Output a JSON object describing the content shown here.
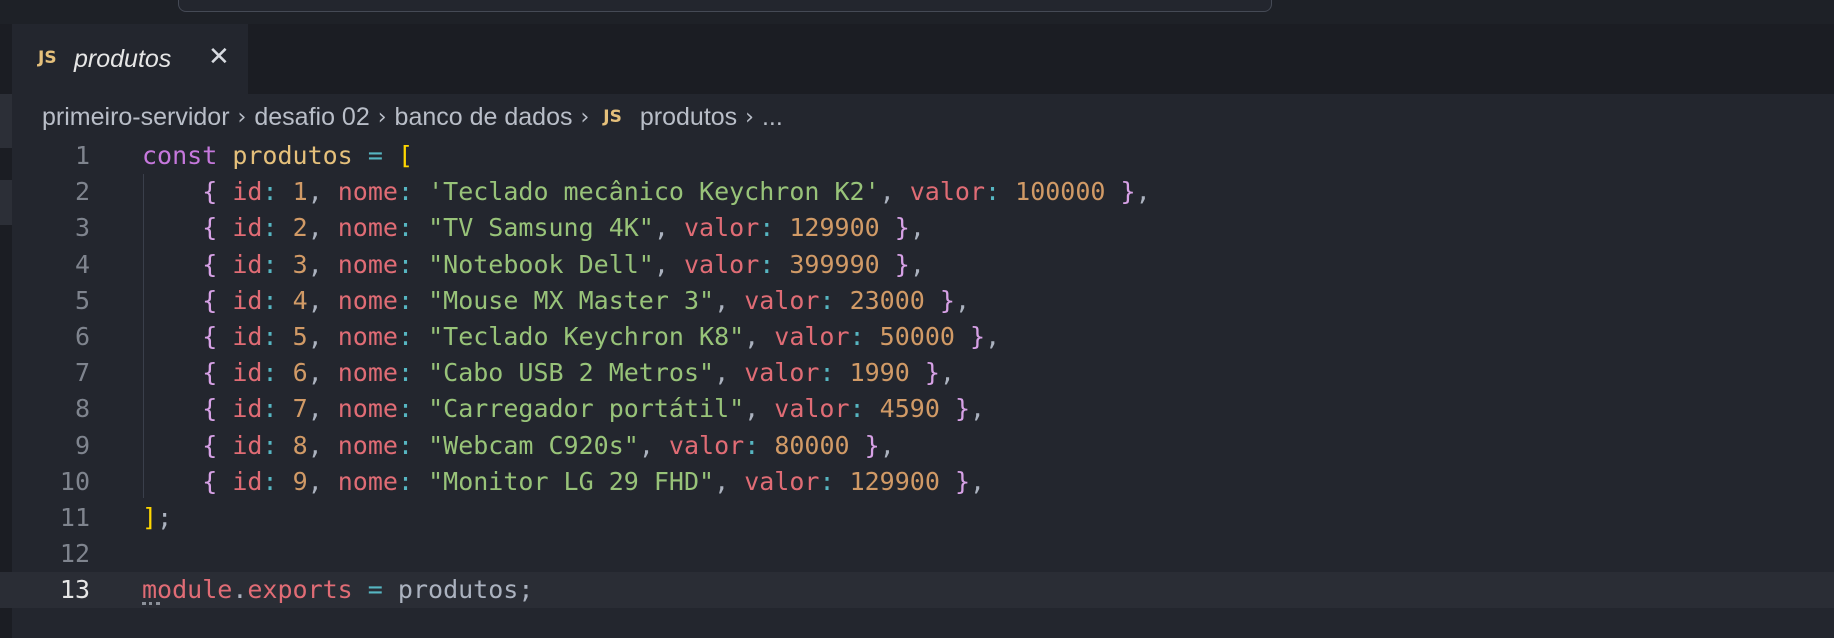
{
  "tab": {
    "icon": "JS",
    "title": "produtos",
    "close_icon": "close-icon"
  },
  "breadcrumb": {
    "items": [
      "primeiro-servidor",
      "desafio 02",
      "banco de dados",
      "produtos",
      "..."
    ],
    "file_icon": "JS"
  },
  "code": {
    "current_line": 13,
    "lines": [
      {
        "n": "1",
        "tokens": [
          [
            "k",
            "const"
          ],
          [
            "pl",
            " "
          ],
          [
            "v",
            "produtos"
          ],
          [
            "pl",
            " "
          ],
          [
            "o",
            "="
          ],
          [
            "pl",
            " "
          ],
          [
            "br1",
            "["
          ]
        ]
      },
      {
        "n": "2",
        "tokens": [
          [
            "pl",
            "    "
          ],
          [
            "b",
            "{"
          ],
          [
            "pl",
            " "
          ],
          [
            "p",
            "id"
          ],
          [
            "o",
            ":"
          ],
          [
            "pl",
            " "
          ],
          [
            "n",
            "1"
          ],
          [
            "pl",
            ", "
          ],
          [
            "p",
            "nome"
          ],
          [
            "o",
            ":"
          ],
          [
            "pl",
            " "
          ],
          [
            "s",
            "'Teclado mecânico Keychron K2'"
          ],
          [
            "pl",
            ", "
          ],
          [
            "p",
            "valor"
          ],
          [
            "o",
            ":"
          ],
          [
            "pl",
            " "
          ],
          [
            "n",
            "100000"
          ],
          [
            "pl",
            " "
          ],
          [
            "b",
            "}"
          ],
          [
            "pl",
            ","
          ]
        ]
      },
      {
        "n": "3",
        "tokens": [
          [
            "pl",
            "    "
          ],
          [
            "b",
            "{"
          ],
          [
            "pl",
            " "
          ],
          [
            "p",
            "id"
          ],
          [
            "o",
            ":"
          ],
          [
            "pl",
            " "
          ],
          [
            "n",
            "2"
          ],
          [
            "pl",
            ", "
          ],
          [
            "p",
            "nome"
          ],
          [
            "o",
            ":"
          ],
          [
            "pl",
            " "
          ],
          [
            "s",
            "\"TV Samsung 4K\""
          ],
          [
            "pl",
            ", "
          ],
          [
            "p",
            "valor"
          ],
          [
            "o",
            ":"
          ],
          [
            "pl",
            " "
          ],
          [
            "n",
            "129900"
          ],
          [
            "pl",
            " "
          ],
          [
            "b",
            "}"
          ],
          [
            "pl",
            ","
          ]
        ]
      },
      {
        "n": "4",
        "tokens": [
          [
            "pl",
            "    "
          ],
          [
            "b",
            "{"
          ],
          [
            "pl",
            " "
          ],
          [
            "p",
            "id"
          ],
          [
            "o",
            ":"
          ],
          [
            "pl",
            " "
          ],
          [
            "n",
            "3"
          ],
          [
            "pl",
            ", "
          ],
          [
            "p",
            "nome"
          ],
          [
            "o",
            ":"
          ],
          [
            "pl",
            " "
          ],
          [
            "s",
            "\"Notebook Dell\""
          ],
          [
            "pl",
            ", "
          ],
          [
            "p",
            "valor"
          ],
          [
            "o",
            ":"
          ],
          [
            "pl",
            " "
          ],
          [
            "n",
            "399990"
          ],
          [
            "pl",
            " "
          ],
          [
            "b",
            "}"
          ],
          [
            "pl",
            ","
          ]
        ]
      },
      {
        "n": "5",
        "tokens": [
          [
            "pl",
            "    "
          ],
          [
            "b",
            "{"
          ],
          [
            "pl",
            " "
          ],
          [
            "p",
            "id"
          ],
          [
            "o",
            ":"
          ],
          [
            "pl",
            " "
          ],
          [
            "n",
            "4"
          ],
          [
            "pl",
            ", "
          ],
          [
            "p",
            "nome"
          ],
          [
            "o",
            ":"
          ],
          [
            "pl",
            " "
          ],
          [
            "s",
            "\"Mouse MX Master 3\""
          ],
          [
            "pl",
            ", "
          ],
          [
            "p",
            "valor"
          ],
          [
            "o",
            ":"
          ],
          [
            "pl",
            " "
          ],
          [
            "n",
            "23000"
          ],
          [
            "pl",
            " "
          ],
          [
            "b",
            "}"
          ],
          [
            "pl",
            ","
          ]
        ]
      },
      {
        "n": "6",
        "tokens": [
          [
            "pl",
            "    "
          ],
          [
            "b",
            "{"
          ],
          [
            "pl",
            " "
          ],
          [
            "p",
            "id"
          ],
          [
            "o",
            ":"
          ],
          [
            "pl",
            " "
          ],
          [
            "n",
            "5"
          ],
          [
            "pl",
            ", "
          ],
          [
            "p",
            "nome"
          ],
          [
            "o",
            ":"
          ],
          [
            "pl",
            " "
          ],
          [
            "s",
            "\"Teclado Keychron K8\""
          ],
          [
            "pl",
            ", "
          ],
          [
            "p",
            "valor"
          ],
          [
            "o",
            ":"
          ],
          [
            "pl",
            " "
          ],
          [
            "n",
            "50000"
          ],
          [
            "pl",
            " "
          ],
          [
            "b",
            "}"
          ],
          [
            "pl",
            ","
          ]
        ]
      },
      {
        "n": "7",
        "tokens": [
          [
            "pl",
            "    "
          ],
          [
            "b",
            "{"
          ],
          [
            "pl",
            " "
          ],
          [
            "p",
            "id"
          ],
          [
            "o",
            ":"
          ],
          [
            "pl",
            " "
          ],
          [
            "n",
            "6"
          ],
          [
            "pl",
            ", "
          ],
          [
            "p",
            "nome"
          ],
          [
            "o",
            ":"
          ],
          [
            "pl",
            " "
          ],
          [
            "s",
            "\"Cabo USB 2 Metros\""
          ],
          [
            "pl",
            ", "
          ],
          [
            "p",
            "valor"
          ],
          [
            "o",
            ":"
          ],
          [
            "pl",
            " "
          ],
          [
            "n",
            "1990"
          ],
          [
            "pl",
            " "
          ],
          [
            "b",
            "}"
          ],
          [
            "pl",
            ","
          ]
        ]
      },
      {
        "n": "8",
        "tokens": [
          [
            "pl",
            "    "
          ],
          [
            "b",
            "{"
          ],
          [
            "pl",
            " "
          ],
          [
            "p",
            "id"
          ],
          [
            "o",
            ":"
          ],
          [
            "pl",
            " "
          ],
          [
            "n",
            "7"
          ],
          [
            "pl",
            ", "
          ],
          [
            "p",
            "nome"
          ],
          [
            "o",
            ":"
          ],
          [
            "pl",
            " "
          ],
          [
            "s",
            "\"Carregador portátil\""
          ],
          [
            "pl",
            ", "
          ],
          [
            "p",
            "valor"
          ],
          [
            "o",
            ":"
          ],
          [
            "pl",
            " "
          ],
          [
            "n",
            "4590"
          ],
          [
            "pl",
            " "
          ],
          [
            "b",
            "}"
          ],
          [
            "pl",
            ","
          ]
        ]
      },
      {
        "n": "9",
        "tokens": [
          [
            "pl",
            "    "
          ],
          [
            "b",
            "{"
          ],
          [
            "pl",
            " "
          ],
          [
            "p",
            "id"
          ],
          [
            "o",
            ":"
          ],
          [
            "pl",
            " "
          ],
          [
            "n",
            "8"
          ],
          [
            "pl",
            ", "
          ],
          [
            "p",
            "nome"
          ],
          [
            "o",
            ":"
          ],
          [
            "pl",
            " "
          ],
          [
            "s",
            "\"Webcam C920s\""
          ],
          [
            "pl",
            ", "
          ],
          [
            "p",
            "valor"
          ],
          [
            "o",
            ":"
          ],
          [
            "pl",
            " "
          ],
          [
            "n",
            "80000"
          ],
          [
            "pl",
            " "
          ],
          [
            "b",
            "}"
          ],
          [
            "pl",
            ","
          ]
        ]
      },
      {
        "n": "10",
        "tokens": [
          [
            "pl",
            "    "
          ],
          [
            "b",
            "{"
          ],
          [
            "pl",
            " "
          ],
          [
            "p",
            "id"
          ],
          [
            "o",
            ":"
          ],
          [
            "pl",
            " "
          ],
          [
            "n",
            "9"
          ],
          [
            "pl",
            ", "
          ],
          [
            "p",
            "nome"
          ],
          [
            "o",
            ":"
          ],
          [
            "pl",
            " "
          ],
          [
            "s",
            "\"Monitor LG 29 FHD\""
          ],
          [
            "pl",
            ", "
          ],
          [
            "p",
            "valor"
          ],
          [
            "o",
            ":"
          ],
          [
            "pl",
            " "
          ],
          [
            "n",
            "129900"
          ],
          [
            "pl",
            " "
          ],
          [
            "b",
            "}"
          ],
          [
            "pl",
            ","
          ]
        ]
      },
      {
        "n": "11",
        "tokens": [
          [
            "br1",
            "]"
          ],
          [
            "pl",
            ";"
          ]
        ]
      },
      {
        "n": "12",
        "tokens": []
      },
      {
        "n": "13",
        "tokens": [
          [
            "p",
            "module"
          ],
          [
            "pl",
            "."
          ],
          [
            "p",
            "exports"
          ],
          [
            "pl",
            " "
          ],
          [
            "o",
            "="
          ],
          [
            "pl",
            " produtos;"
          ]
        ]
      }
    ]
  },
  "colors": {
    "editor_bg": "#23262e",
    "keyword": "#c678dd",
    "string": "#98c379",
    "number": "#d19a66",
    "property": "#e06c75"
  }
}
